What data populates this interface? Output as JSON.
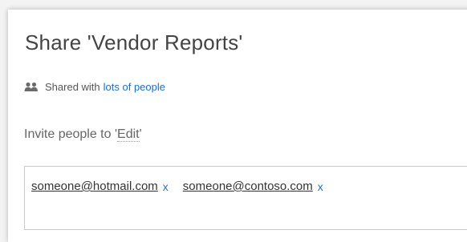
{
  "dialog": {
    "title": "Share 'Vendor Reports'",
    "shared_with_text": "Shared with",
    "shared_with_link": "lots of people",
    "invite_prefix": "Invite people to ",
    "invite_permission_open": "'",
    "invite_permission": "Edit",
    "invite_permission_close": "'",
    "recipients": [
      {
        "email": "someone@hotmail.com",
        "remove": "x"
      },
      {
        "email": "someone@contoso.com",
        "remove": "x"
      }
    ]
  },
  "colors": {
    "link": "#1e6fbf",
    "title": "#444444",
    "border": "#c9c9c9"
  },
  "icons": {
    "shared": "people-icon"
  }
}
